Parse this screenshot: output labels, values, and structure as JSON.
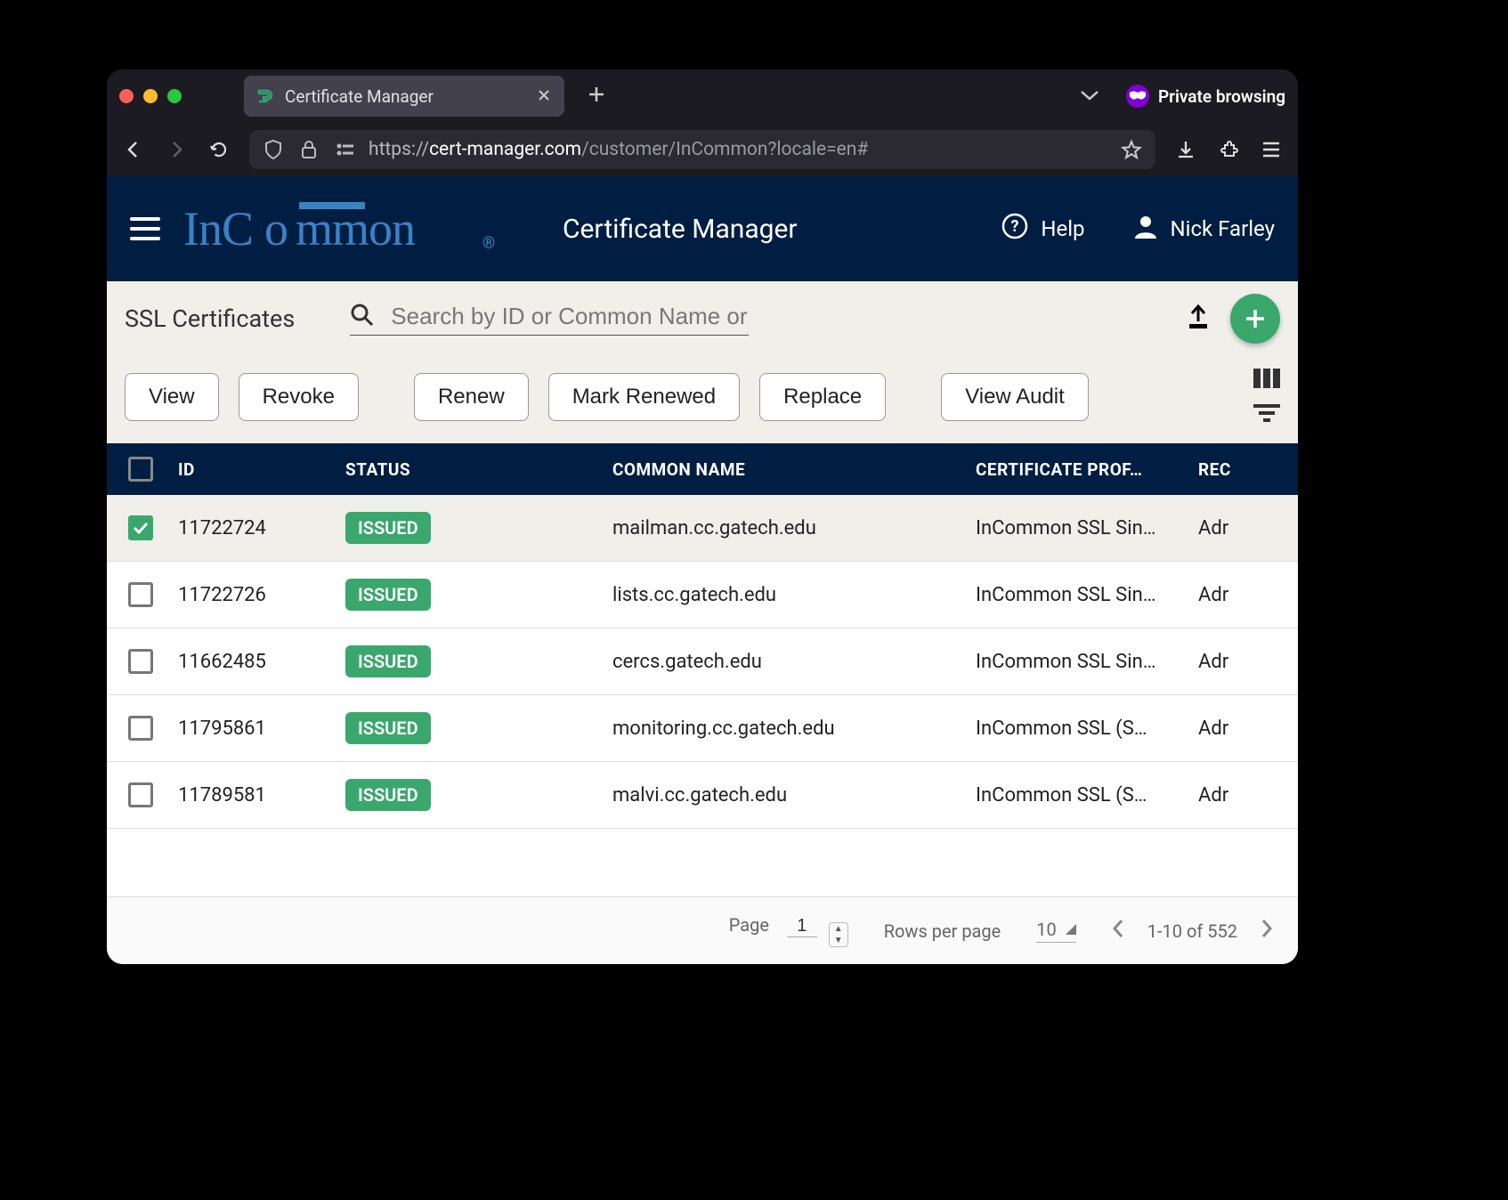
{
  "browser": {
    "tab_title": "Certificate Manager",
    "private_label": "Private browsing",
    "url_scheme": "https://",
    "url_host": "cert-manager.com",
    "url_rest": "/customer/InCommon?locale=en#"
  },
  "header": {
    "app_title": "Certificate Manager",
    "help_label": "Help",
    "user_name": "Nick Farley"
  },
  "toolbar": {
    "page_subtitle": "SSL Certificates",
    "search_placeholder": "Search by ID or Common Name or Su"
  },
  "actions": {
    "view": "View",
    "revoke": "Revoke",
    "renew": "Renew",
    "mark_renewed": "Mark Renewed",
    "replace": "Replace",
    "view_audit": "View Audit"
  },
  "columns": {
    "id": "ID",
    "status": "STATUS",
    "common_name": "COMMON NAME",
    "profile": "CERTIFICATE PROF…",
    "rec": "REC"
  },
  "rows": [
    {
      "selected": true,
      "id": "11722724",
      "status": "ISSUED",
      "cn": "mailman.cc.gatech.edu",
      "profile": "InCommon SSL Sin…",
      "rec": "Adr"
    },
    {
      "selected": false,
      "id": "11722726",
      "status": "ISSUED",
      "cn": "lists.cc.gatech.edu",
      "profile": "InCommon SSL Sin…",
      "rec": "Adr"
    },
    {
      "selected": false,
      "id": "11662485",
      "status": "ISSUED",
      "cn": "cercs.gatech.edu",
      "profile": "InCommon SSL Sin…",
      "rec": "Adr"
    },
    {
      "selected": false,
      "id": "11795861",
      "status": "ISSUED",
      "cn": "monitoring.cc.gatech.edu",
      "profile": "InCommon SSL (S…",
      "rec": "Adr"
    },
    {
      "selected": false,
      "id": "11789581",
      "status": "ISSUED",
      "cn": "malvi.cc.gatech.edu",
      "profile": "InCommon SSL (S…",
      "rec": "Adr"
    }
  ],
  "pager": {
    "page_label": "Page",
    "page_value": "1",
    "rows_label": "Rows per page",
    "rows_value": "10",
    "range_label": "1-10 of 552"
  }
}
